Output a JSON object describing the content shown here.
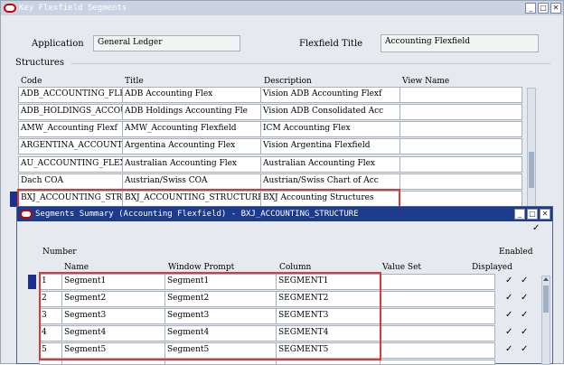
{
  "main_window": {
    "title": "Key Flexfield Segments",
    "buttons": [
      "_",
      "□",
      "✕"
    ],
    "application_label": "Application",
    "application_value": "General Ledger",
    "flexfield_title_label": "Flexfield Title",
    "flexfield_title_value": "Accounting Flexfield",
    "structures_label": "Structures",
    "columns": [
      "Code",
      "Title",
      "Description",
      "View Name"
    ],
    "rows": [
      [
        "ADB_ACCOUNTING_FLEX",
        "ADB Accounting Flex",
        "Vision ADB Accounting Flexf",
        ""
      ],
      [
        "ADB_HOLDINGS_ACCOUNT",
        "ADB Holdings Accounting Fle",
        "Vision ADB Consolidated Acc",
        ""
      ],
      [
        "AMW_Accounting Flexf",
        "AMW_Accounting Flexfield",
        "ICM Accounting Flex",
        ""
      ],
      [
        "ARGENTINA_ACCOUNTING",
        "Argentina Accounting Flex",
        "Vision Argentina Flexfield",
        ""
      ],
      [
        "AU_ACCOUNTING_FLEXFI",
        "Australian Accounting Flex",
        "Australian Accounting Flex",
        ""
      ],
      [
        "Dach COA",
        "Austrian/Swiss COA",
        "Austrian/Swiss Chart of Acc",
        ""
      ],
      [
        "BXJ_ACCOUNTING_STRUC",
        "BXJ_ACCOUNTING_STRUCTURE",
        "BXJ Accounting Structures",
        ""
      ]
    ]
  },
  "segments_window": {
    "title": "Segments Summary (Accounting Flexfield) - BXJ_ACCOUNTING_STRUCTURE",
    "buttons": [
      "_",
      "□",
      "✕"
    ],
    "header_check": "✓",
    "columns": {
      "number_label": "Number",
      "name": "Name",
      "window_prompt": "Window Prompt",
      "column": "Column",
      "value_set": "Value Set",
      "enabled": "Enabled",
      "displayed": "Displayed"
    },
    "rows": [
      {
        "num": "1",
        "name": "Segment1",
        "prompt": "Segment1",
        "column": "SEGMENT1",
        "value_set": "",
        "displayed": "✓",
        "enabled": "✓"
      },
      {
        "num": "2",
        "name": "Segment2",
        "prompt": "Segment2",
        "column": "SEGMENT2",
        "value_set": "",
        "displayed": "✓",
        "enabled": "✓"
      },
      {
        "num": "3",
        "name": "Segment3",
        "prompt": "Segment3",
        "column": "SEGMENT3",
        "value_set": "",
        "displayed": "✓",
        "enabled": "✓"
      },
      {
        "num": "4",
        "name": "Segment4",
        "prompt": "Segment4",
        "column": "SEGMENT4",
        "value_set": "",
        "displayed": "✓",
        "enabled": "✓"
      },
      {
        "num": "5",
        "name": "Segment5",
        "prompt": "Segment5",
        "column": "SEGMENT5",
        "value_set": "",
        "displayed": "✓",
        "enabled": "✓"
      }
    ]
  },
  "colors": {
    "titlebar_inactive": "#c9d3e2",
    "titlebar_active": "#1e3a8c",
    "window_bg": "#e6eaee",
    "highlight": "#d63a3a",
    "selection_marker": "#1a2f8f"
  }
}
